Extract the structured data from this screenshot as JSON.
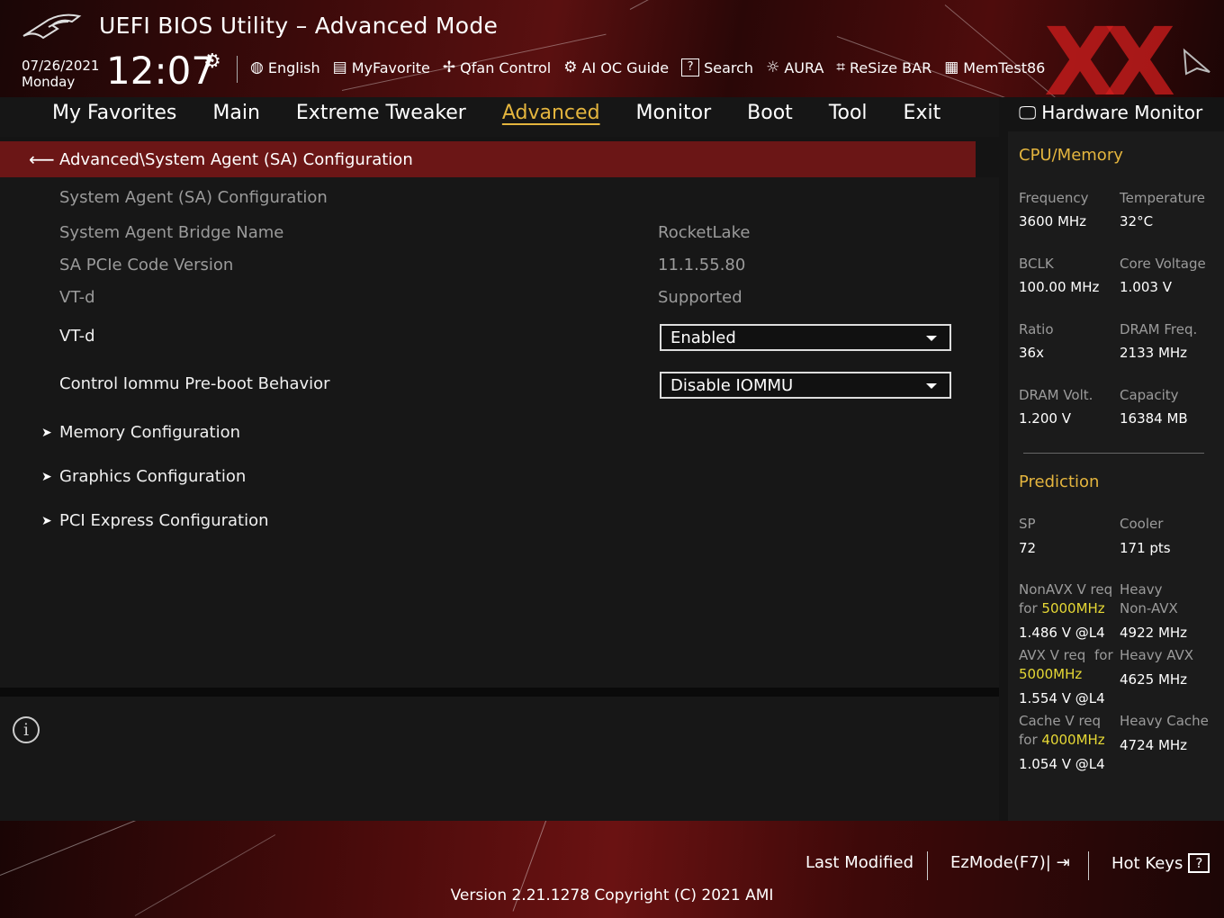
{
  "header": {
    "title": "UEFI BIOS Utility – Advanced Mode",
    "date": "07/26/2021",
    "day": "Monday",
    "time": "12:07",
    "tools": [
      {
        "label": "English",
        "icon": "globe-icon",
        "glyph": "🌐"
      },
      {
        "label": "MyFavorite",
        "icon": "favorite-icon",
        "glyph": "▤"
      },
      {
        "label": "Qfan Control",
        "icon": "fan-icon",
        "glyph": "✇"
      },
      {
        "label": "AI OC Guide",
        "icon": "ai-chip-icon",
        "glyph": "⚙"
      },
      {
        "label": "Search",
        "icon": "search-icon",
        "glyph": "?"
      },
      {
        "label": "AURA",
        "icon": "aura-light-icon",
        "glyph": "☼"
      },
      {
        "label": "ReSize BAR",
        "icon": "resize-bar-icon",
        "glyph": "⌗"
      },
      {
        "label": "MemTest86",
        "icon": "memtest-icon",
        "glyph": "▦"
      }
    ]
  },
  "menu": {
    "items": [
      "My Favorites",
      "Main",
      "Extreme Tweaker",
      "Advanced",
      "Monitor",
      "Boot",
      "Tool",
      "Exit"
    ],
    "active": "Advanced"
  },
  "breadcrumb": "Advanced\\System Agent (SA) Configuration",
  "settings": {
    "section_title": "System Agent (SA) Configuration",
    "bridge_label": "System Agent Bridge Name",
    "bridge_value": "RocketLake",
    "pcie_label": "SA PCIe Code Version",
    "pcie_value": "11.1.55.80",
    "vtd_info_label": "VT-d",
    "vtd_info_value": "Supported",
    "vtd_label": "VT-d",
    "vtd_value": "Enabled",
    "iommu_label": "Control Iommu Pre-boot Behavior",
    "iommu_value": "Disable IOMMU",
    "submenus": [
      "Memory Configuration",
      "Graphics Configuration",
      "PCI Express Configuration"
    ]
  },
  "hardware_monitor": {
    "title": "Hardware Monitor",
    "cpu_section": "CPU/Memory",
    "cpu": {
      "frequency_label": "Frequency",
      "frequency_value": "3600 MHz",
      "temperature_label": "Temperature",
      "temperature_value": "32°C",
      "bclk_label": "BCLK",
      "bclk_value": "100.00 MHz",
      "core_voltage_label": "Core Voltage",
      "core_voltage_value": "1.003 V",
      "ratio_label": "Ratio",
      "ratio_value": "36x",
      "dram_freq_label": "DRAM Freq.",
      "dram_freq_value": "2133 MHz",
      "dram_volt_label": "DRAM Volt.",
      "dram_volt_value": "1.200 V",
      "capacity_label": "Capacity",
      "capacity_value": "16384 MB"
    },
    "prediction_section": "Prediction",
    "prediction": {
      "sp_label": "SP",
      "sp_value": "72",
      "cooler_label": "Cooler",
      "cooler_value": "171 pts",
      "nonavx_label1": "NonAVX V req",
      "nonavx_label2_pre": "for ",
      "nonavx_freq": "5000MHz",
      "nonavx_value": "1.486 V @L4",
      "heavy_nonavx_label1": "Heavy",
      "heavy_nonavx_label2": "Non-AVX",
      "heavy_nonavx_value": "4922 MHz",
      "avx_label1": "AVX V req",
      "avx_label1b": "for",
      "avx_freq": "5000MHz",
      "avx_value": "1.554 V @L4",
      "heavy_avx_label": "Heavy AVX",
      "heavy_avx_value": "4625 MHz",
      "cache_label1": "Cache V req",
      "cache_label2_pre": "for ",
      "cache_freq": "4000MHz",
      "cache_value": "1.054 V @L4",
      "heavy_cache_label": "Heavy Cache",
      "heavy_cache_value": "4724 MHz"
    }
  },
  "footer": {
    "last_modified": "Last Modified",
    "ezmode": "EzMode(F7)|",
    "hotkeys": "Hot Keys",
    "hotkeys_glyph": "?",
    "version": "Version 2.21.1278 Copyright (C) 2021 AMI"
  },
  "colors": {
    "accent": "#e4b53e",
    "highlight": "#e6d835",
    "breadcrumb_bg": "#6b1616"
  }
}
